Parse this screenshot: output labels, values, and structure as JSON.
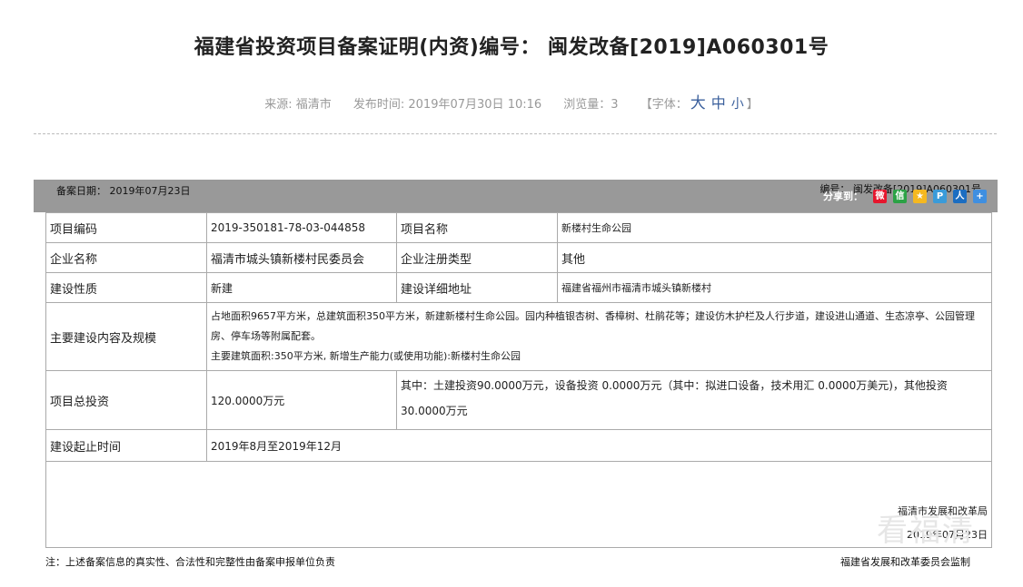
{
  "header": {
    "title": "福建省投资项目备案证明(内资)编号： 闽发改备[2019]A060301号",
    "source": "来源: 福清市",
    "publish_time": "发布时间: 2019年07月30日 10:16",
    "views": "浏览量：3",
    "font_label_open": "【字体：",
    "font_big": "大",
    "font_mid": "中",
    "font_small": "小",
    "font_label_close": "】"
  },
  "bar": {
    "record_date": "备案日期： 2019年07月23日",
    "number": "编号： 闽发改备[2019]A060301号",
    "share_label": "分享到：",
    "share_icons": [
      "weibo-icon",
      "wechat-icon",
      "qzone-icon",
      "tencent-weibo-icon",
      "renren-icon",
      "more-icon"
    ],
    "colors": {
      "bar_bg": "#999999",
      "weibo": "#e6162d",
      "wechat": "#2ba245",
      "qzone": "#f5b820",
      "tweibo": "#3a9bd9",
      "renren": "#1b6dc1",
      "more": "#3f8fe0"
    }
  },
  "table": {
    "project_code_label": "项目编码",
    "project_code": "2019-350181-78-03-044858",
    "project_name_label": "项目名称",
    "project_name": "新楼村生命公园",
    "company_label": "企业名称",
    "company": "福清市城头镇新楼村民委员会",
    "reg_type_label": "企业注册类型",
    "reg_type": "其他",
    "nature_label": "建设性质",
    "nature": "新建",
    "address_label": "建设详细地址",
    "address": "福建省福州市福清市城头镇新楼村",
    "content_label": "主要建设内容及规模",
    "content_line1": "占地面积9657平方米，总建筑面积350平方米，新建新楼村生命公园。园内种植银杏树、香樟树、杜鹃花等；建设仿木护栏及人行步道，建设进山通道、生态凉亭、公园管理房、停车场等附属配套。",
    "content_line2": "主要建筑面积:350平方米, 新增生产能力(或使用功能):新楼村生命公园",
    "investment_label": "项目总投资",
    "investment": "120.0000万元",
    "investment_detail": "其中：土建投资90.0000万元，设备投资 0.0000万元（其中：拟进口设备，技术用汇 0.0000万美元)，其他投资 30.0000万元",
    "period_label": "建设起止时间",
    "period": "2019年8月至2019年12月",
    "issuer": "福清市发展和改革局",
    "issue_date": "2019年07月23日"
  },
  "footer": {
    "note": "注：上述备案信息的真实性、合法性和完整性由备案申报单位负责",
    "supervisor": "福建省发展和改革委员会监制"
  },
  "watermark": "看福清"
}
